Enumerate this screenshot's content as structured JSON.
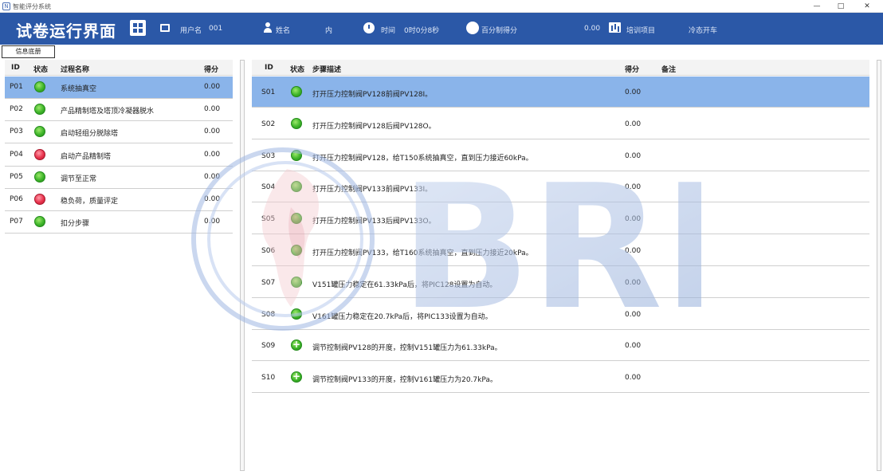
{
  "window": {
    "title": "智能评分系统",
    "icon_glyph": "N",
    "minimize": "—",
    "maximize": "□",
    "close": "✕"
  },
  "header": {
    "title": "试卷运行界面",
    "user_label": "用户名",
    "user_value": "001",
    "name_label": "姓名",
    "name_value": "内",
    "time_label": "时间",
    "time_value": "0时0分8秒",
    "score_label": "百分制得分",
    "score_value": "0.00",
    "project_label": "培训项目",
    "mode_label": "冷态开车",
    "percent_glyph": "%"
  },
  "toolbar": {
    "info_button": "信息底册"
  },
  "left_table": {
    "headers": {
      "id": "ID",
      "status": "状态",
      "name": "过程名称",
      "score": "得分"
    },
    "rows": [
      {
        "id": "P01",
        "status": "green",
        "name": "系统抽真空",
        "score": "0.00",
        "selected": true
      },
      {
        "id": "P02",
        "status": "green",
        "name": "产品精制塔及塔顶冷凝器脱水",
        "score": "0.00",
        "selected": false
      },
      {
        "id": "P03",
        "status": "green",
        "name": "启动轻组分脱除塔",
        "score": "0.00",
        "selected": false
      },
      {
        "id": "P04",
        "status": "red",
        "name": "启动产品精制塔",
        "score": "0.00",
        "selected": false
      },
      {
        "id": "P05",
        "status": "green",
        "name": "调节至正常",
        "score": "0.00",
        "selected": false
      },
      {
        "id": "P06",
        "status": "red",
        "name": "稳负荷，质量评定",
        "score": "0.00",
        "selected": false
      },
      {
        "id": "P07",
        "status": "green",
        "name": "扣分步骤",
        "score": "0.00",
        "selected": false
      }
    ]
  },
  "right_table": {
    "headers": {
      "id": "ID",
      "status": "状态",
      "desc": "步骤描述",
      "score": "得分",
      "note": "备注"
    },
    "rows": [
      {
        "id": "S01",
        "status": "green",
        "desc": "打开压力控制阀PV128前阀PV128I。",
        "score": "0.00",
        "selected": true
      },
      {
        "id": "S02",
        "status": "green",
        "desc": "打开压力控制阀PV128后阀PV128O。",
        "score": "0.00",
        "selected": false
      },
      {
        "id": "S03",
        "status": "green",
        "desc": "打开压力控制阀PV128，给T150系统抽真空，直到压力接近60kPa。",
        "score": "0.00",
        "selected": false
      },
      {
        "id": "S04",
        "status": "green",
        "desc": "打开压力控制阀PV133前阀PV133I。",
        "score": "0.00",
        "selected": false
      },
      {
        "id": "S05",
        "status": "green",
        "desc": "打开压力控制阀PV133后阀PV133O。",
        "score": "0.00",
        "selected": false
      },
      {
        "id": "S06",
        "status": "green",
        "desc": "打开压力控制阀PV133，给T160系统抽真空，直到压力接近20kPa。",
        "score": "0.00",
        "selected": false
      },
      {
        "id": "S07",
        "status": "green",
        "desc": "V151罐压力稳定在61.33kPa后，将PIC128设置为自动。",
        "score": "0.00",
        "selected": false
      },
      {
        "id": "S08",
        "status": "green",
        "desc": "V161罐压力稳定在20.7kPa后，将PIC133设置为自动。",
        "score": "0.00",
        "selected": false
      },
      {
        "id": "S09",
        "status": "green-plus",
        "desc": "调节控制阀PV128的开度，控制V151罐压力为61.33kPa。",
        "score": "0.00",
        "selected": false
      },
      {
        "id": "S10",
        "status": "green-plus",
        "desc": "调节控制阀PV133的开度，控制V161罐压力为20.7kPa。",
        "score": "0.00",
        "selected": false
      }
    ]
  },
  "watermark": {
    "text": "BRL"
  }
}
